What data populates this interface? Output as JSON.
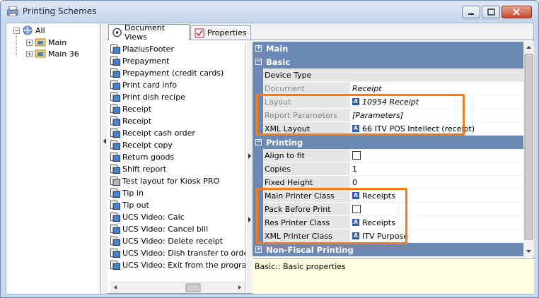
{
  "window": {
    "title": "Printing Schemes"
  },
  "tree": {
    "items": [
      {
        "label": "All"
      },
      {
        "label": "Main"
      },
      {
        "label": "Main 36"
      }
    ]
  },
  "tabs": [
    {
      "label": "Document Views"
    },
    {
      "label": "Properties"
    }
  ],
  "documents": [
    "PlaziusFooter",
    "Prepayment",
    "Prepayment (credit cards)",
    "Print card info",
    "Print dish recipe",
    "Receipt",
    "Receipt",
    "Receipt cash order",
    "Receipt copy",
    "Return goods",
    "Shift report",
    "Test layout for Kiosk PRO",
    "Tip in",
    "Tip out",
    "UCS Video: Calc",
    "UCS Video: Cancel bill",
    "UCS Video: Delete receipt",
    "UCS Video: Dish transfer to order",
    "UCS Video: Exit from the program"
  ],
  "grid": {
    "categories": {
      "main": "Main",
      "basic": "Basic",
      "printing": "Printing",
      "nonfiscal": "Non-Fiscal Printing"
    },
    "basic": {
      "device_type": {
        "name": "Device Type",
        "value": ""
      },
      "document": {
        "name": "Document",
        "value": "Receipt"
      },
      "layout": {
        "name": "Layout",
        "value": "10954 Receipt"
      },
      "report_params": {
        "name": "Report Parameters",
        "value": "[Parameters]"
      },
      "xml_layout": {
        "name": "XML Layout",
        "value": "66 ITV POS Intellect (receipt)"
      }
    },
    "printing": {
      "align": {
        "name": "Align to fit",
        "checked": false
      },
      "copies": {
        "name": "Copies",
        "value": "1"
      },
      "fixed_height": {
        "name": "Fixed Height",
        "value": "0"
      },
      "main_printer": {
        "name": "Main Printer Class",
        "value": "Receipts"
      },
      "pack": {
        "name": "Pack Before Print",
        "checked": false
      },
      "res_printer": {
        "name": "Res Printer Class",
        "value": "Receipts"
      },
      "xml_printer": {
        "name": "XML Printer Class",
        "value": "ITV Purpose"
      }
    }
  },
  "description": "Basic:: Basic properties",
  "colors": {
    "category": "#6b89b4",
    "highlight": "#f07d22",
    "description_bg": "#ffffe1"
  }
}
